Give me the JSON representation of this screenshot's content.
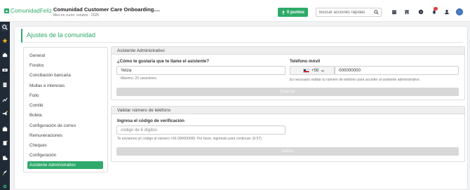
{
  "header": {
    "logo_text": "ComunidadFeliz",
    "community_title": "Comunidad Customer Care Onboarding....",
    "community_subtitle": "Mes en curso: octubre - 2025",
    "points_label": "0 puntos",
    "search_placeholder": "Buscar acciones rápidas",
    "notification_count": "",
    "icons": [
      "building-icon",
      "store-icon",
      "help-icon",
      "bell-icon",
      "user-icon",
      "globe-icon"
    ]
  },
  "rail": {
    "icons": [
      "search-icon",
      "star-icon",
      "home-icon",
      "money-icon",
      "building-icon",
      "chart-icon",
      "announce-icon",
      "briefcase-icon",
      "notes-icon",
      "building-admin-icon",
      "rocket-icon",
      "gear-icon"
    ]
  },
  "page": {
    "title": "Ajustes de la comunidad"
  },
  "menu": {
    "items": [
      "General",
      "Fondos",
      "Conciliación bancaria",
      "Multas e intereses",
      "Folio",
      "Comité",
      "Boleta",
      "Configuración de correo",
      "Remuneraciones",
      "Cheques",
      "Configuración",
      "Asistente Administrativo"
    ],
    "active_index": 11
  },
  "assistant": {
    "title": "Asistente Administrativo",
    "name_label": "¿Cómo te gustaría que te llame el asistente?",
    "name_value": "Yetza",
    "name_hint": "Máximo: 20 caracteres.",
    "phone_label": "Teléfono móvil",
    "country_code": "+56",
    "phone_value": "000000000",
    "phone_hint": "Es necesario validar tu número de teléfono para acceder al asistente administrativo.",
    "save_label": "Guardar"
  },
  "validate": {
    "title": "Validar número de teléfono",
    "code_label": "Ingresa el código de verificación",
    "code_placeholder": "código de 6 dígitos",
    "code_hint": "Te enviamos un código al número +56 000000000. Por favor, ingrésalo para continuar. (0:57)",
    "validate_label": "Validar"
  },
  "colors": {
    "accent": "#2eaa6a",
    "rail": "#1f2a36",
    "disabled": "#d8d8d8"
  }
}
